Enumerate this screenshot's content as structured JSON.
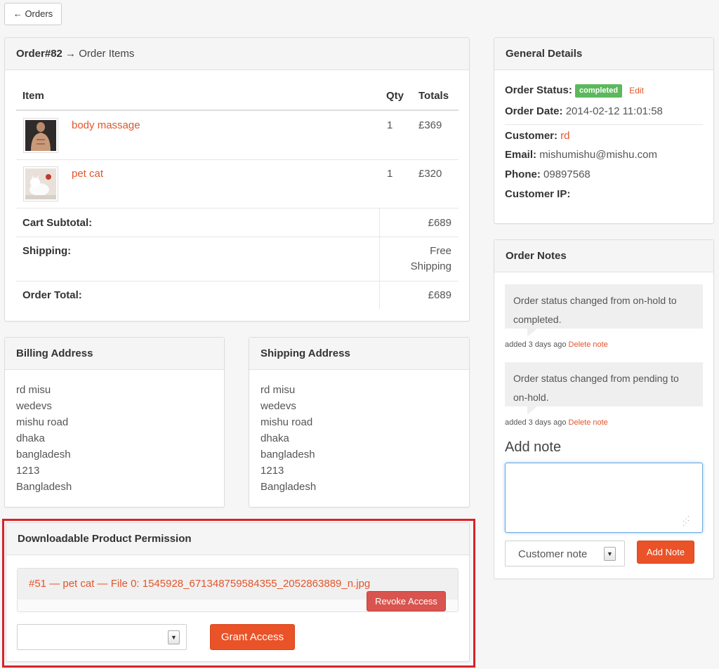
{
  "back_button": {
    "arrow": "←",
    "label": "Orders"
  },
  "order_items": {
    "header_bold": "Order#82",
    "header_rest": " → Order Items",
    "columns": {
      "item": "Item",
      "qty": "Qty",
      "totals": "Totals"
    },
    "rows": [
      {
        "name": "body massage",
        "qty": "1",
        "total": "£369"
      },
      {
        "name": "pet cat",
        "qty": "1",
        "total": "£320"
      }
    ],
    "cart_subtotal_label": "Cart Subtotal:",
    "cart_subtotal_value": "£689",
    "shipping_label": "Shipping:",
    "shipping_value_line1": "Free",
    "shipping_value_line2": "Shipping",
    "order_total_label": "Order Total:",
    "order_total_value": "£689"
  },
  "billing": {
    "title": "Billing Address",
    "lines": [
      "rd misu",
      "wedevs",
      "mishu road",
      "dhaka",
      "bangladesh",
      "1213",
      "Bangladesh"
    ]
  },
  "shipping": {
    "title": "Shipping Address",
    "lines": [
      "rd misu",
      "wedevs",
      "mishu road",
      "dhaka",
      "bangladesh",
      "1213",
      "Bangladesh"
    ]
  },
  "downloads": {
    "title": "Downloadable Product Permission",
    "file_label": "#51 — pet cat — File 0: 1545928_671348759584355_2052863889_n.jpg",
    "revoke_label": "Revoke Access",
    "select_value": "",
    "grant_label": "Grant Access"
  },
  "general": {
    "title": "General Details",
    "status_label": "Order Status:",
    "status_value": "completed",
    "edit_label": "Edit",
    "date_label": "Order Date:",
    "date_value": "2014-02-12 11:01:58",
    "customer_label": "Customer:",
    "customer_value": "rd",
    "email_label": "Email:",
    "email_value": "mishumishu@mishu.com",
    "phone_label": "Phone:",
    "phone_value": "09897568",
    "ip_label": "Customer IP:",
    "ip_value": ""
  },
  "notes": {
    "title": "Order Notes",
    "items": [
      {
        "text": "Order status changed from on-hold to completed.",
        "meta": "added 3 days ago",
        "delete": "Delete note"
      },
      {
        "text": "Order status changed from pending to on-hold.",
        "meta": "added 3 days ago",
        "delete": "Delete note"
      }
    ],
    "add_title": "Add note",
    "note_value": "",
    "type_value": "Customer note",
    "add_button": "Add Note"
  },
  "colors": {
    "accent": "#e2552b",
    "button": "#ea5227",
    "badge": "#5cb85c",
    "highlight_border": "#d8232a"
  },
  "icons": {
    "select_arrow": "chevron-down-icon",
    "resize": "resize-grip-icon"
  }
}
